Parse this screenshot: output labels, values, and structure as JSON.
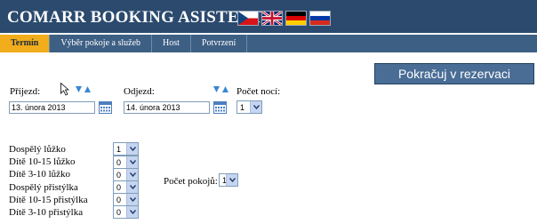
{
  "app": {
    "title": "COMARR BOOKING ASISTENT"
  },
  "languages": [
    "czech-flag",
    "uk-flag",
    "german-flag",
    "russian-flag"
  ],
  "tabs": [
    {
      "label": "Termín",
      "active": true
    },
    {
      "label": "Výběr pokoje a služeb",
      "active": false
    },
    {
      "label": "Host",
      "active": false
    },
    {
      "label": "Potvrzení",
      "active": false
    }
  ],
  "continue_button": {
    "label": "Pokračuj v rezervaci"
  },
  "arrival": {
    "label": "Příjezd:",
    "value": "13. února 2013"
  },
  "departure": {
    "label": "Odjezd:",
    "value": "14. února 2013"
  },
  "nights": {
    "label": "Počet nocí:",
    "value": "1"
  },
  "guests": [
    {
      "label": "Dospělý lůžko",
      "value": "1"
    },
    {
      "label": "Dítě 10-15 lůžko",
      "value": "0"
    },
    {
      "label": "Dítě 3-10 lůžko",
      "value": "0"
    },
    {
      "label": "Dospělý přistýlka",
      "value": "0"
    },
    {
      "label": "Dítě 10-15 přistýlka",
      "value": "0"
    },
    {
      "label": "Dítě 3-10 přistýlka",
      "value": "0"
    }
  ],
  "rooms": {
    "label": "Počet pokojů:",
    "value": "1"
  },
  "colors": {
    "header": "#2b4a6e",
    "tabbar": "#3e5f84",
    "active_tab": "#f2ad1c",
    "button": "#4a6d96"
  }
}
